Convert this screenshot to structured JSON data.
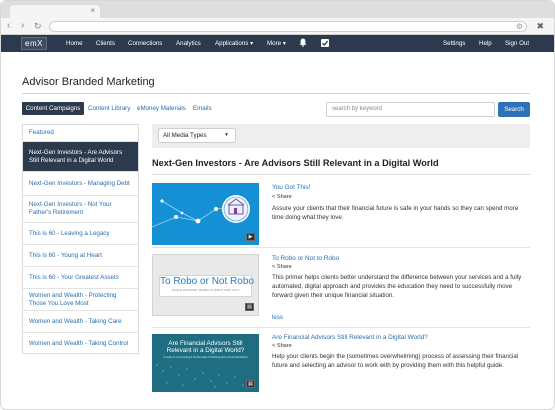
{
  "nav": {
    "logo": "emX",
    "items": [
      "Home",
      "Clients",
      "Connections",
      "Analytics",
      "Applications ▾",
      "More ▾"
    ],
    "right_items": [
      "Settings",
      "Help",
      "Sign Out"
    ]
  },
  "page": {
    "title": "Advisor Branded Marketing"
  },
  "subtabs": [
    "Content Campaigns",
    "Content Library",
    "eMoney Materials",
    "Emails"
  ],
  "search": {
    "placeholder": "search by keyword",
    "button": "Search"
  },
  "sidebar": {
    "items": [
      "Featured",
      "Next-Gen Investors - Are Advisors Still Relevant in a Digital World",
      "Next-Gen Investors - Managing Debt",
      "Next-Gen Investors - Not Your Father's Retirement",
      "This is 60 - Leaving a Legacy",
      "This is 60 - Young at Heart",
      "This is 60 - Your Greatest Assets",
      "Women and Wealth - Protecting Those You Love Most",
      "Women and Wealth - Taking Care",
      "Women and Wealth - Taking Control"
    ],
    "active_index": 1
  },
  "filter": {
    "media_types": "All Media Types"
  },
  "section": {
    "title": "Next-Gen Investors - Are Advisors Still Relevant in a Digital World"
  },
  "items": [
    {
      "title": "You Got This!",
      "share": "Share",
      "description": "Assure your clients that their financial future is safe in your hands so they can spend more time doing what they love.",
      "media_icon": "video-icon"
    },
    {
      "title": "To Robo or Not to Robo",
      "share": "Share",
      "description": "This primer helps clients better understand the difference between your services and a fully automated, digital approach and provides the education they need to successfully move forward given their unique financial situation.",
      "thumb_title": "To Robo or Not Robo",
      "thumb_sub": "WHICH ADVISORY MODEL IS RIGHT FOR YOU?",
      "media_icon": "document-icon"
    },
    {
      "title": "Are Financial Advisors Still Relevant in a Digital World?",
      "share": "Share",
      "description": "Help your clients begin the (sometimes overwhelming) process of assessing their financial future and selecting an advisor to work with by providing them with this helpful guide.",
      "thumb_title": "Are Financial Advisors Still Relevant in a Digital World?",
      "thumb_sub": "A Guide to Overcoming & the Benefits of Working with a Financial Advisor",
      "media_icon": "document-icon"
    }
  ],
  "less_label": "less",
  "colors": {
    "nav_bg": "#2b3a4d",
    "link": "#2a6fb0",
    "accent_button": "#2e71b8"
  }
}
